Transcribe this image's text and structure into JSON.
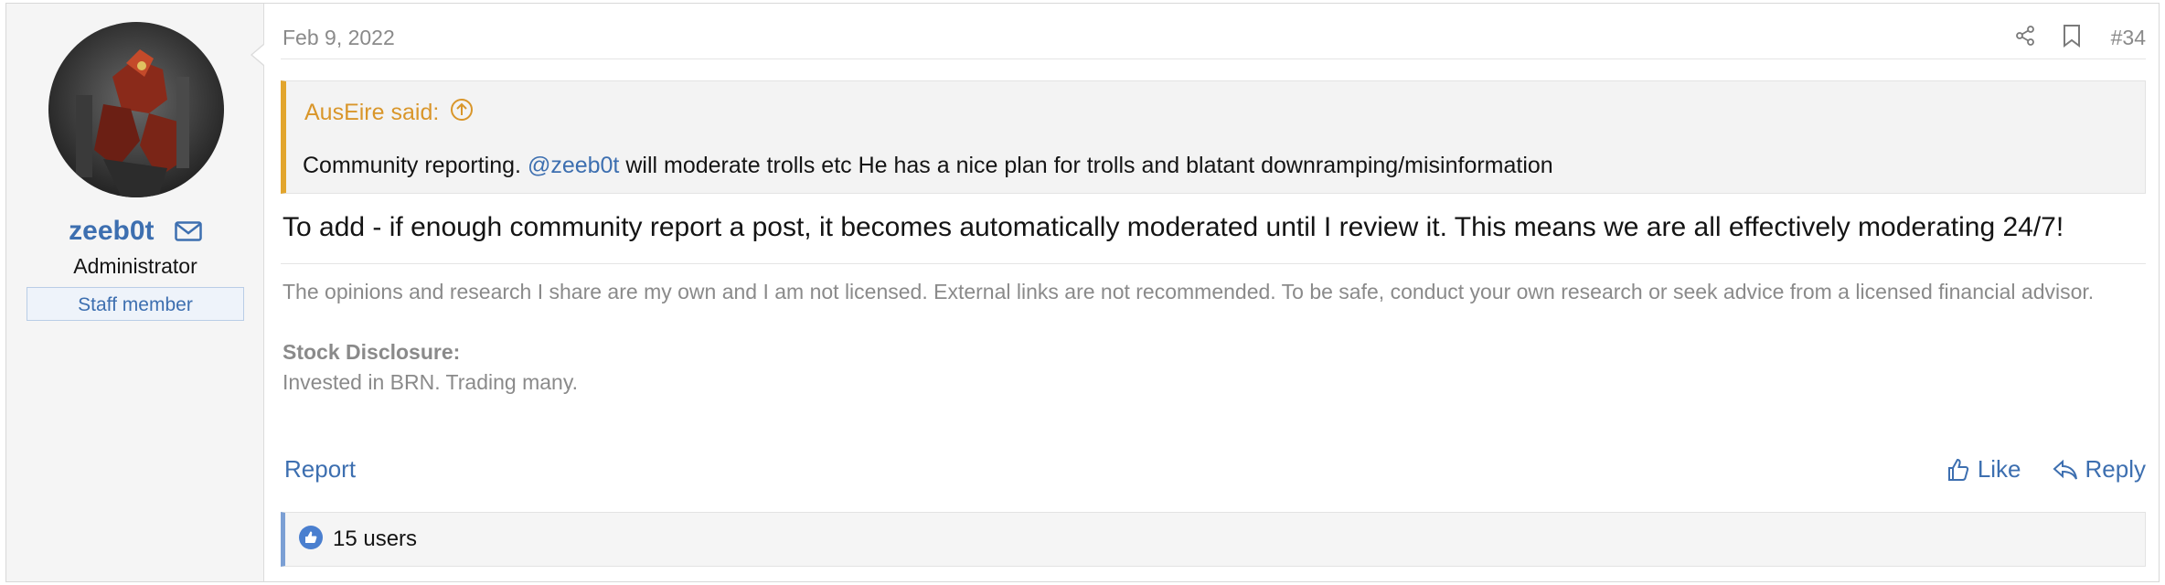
{
  "post": {
    "date": "Feb 9, 2022",
    "number": "#34",
    "header_icons": [
      "share-icon",
      "bookmark-icon"
    ]
  },
  "user": {
    "name": "zeeb0t",
    "role": "Administrator",
    "badge": "Staff member",
    "icons": [
      "mail-icon"
    ]
  },
  "quote": {
    "author": "AusEire said:",
    "body_prefix": "Community reporting. ",
    "mention": "@zeeb0t",
    "body_suffix": " will moderate trolls etc He has a nice plan for trolls and blatant downramping/misinformation"
  },
  "message": "To add - if enough community report a post, it becomes automatically moderated until I review it. This means we are all effectively moderating 24/7!",
  "signature": {
    "line1": "The opinions and research I share are my own and I am not licensed. External links are not recommended. To be safe, conduct your own research or seek advice from a licensed financial advisor.",
    "disclosure_label": "Stock Disclosure:",
    "disclosure_text": "Invested in BRN. Trading many."
  },
  "actions": {
    "report": "Report",
    "like": "Like",
    "reply": "Reply"
  },
  "reactions": {
    "count_text": "15 users"
  },
  "colors": {
    "link": "#3d6fb0",
    "quote_accent": "#e2a52d",
    "reaction_accent": "#7b9fd4"
  }
}
